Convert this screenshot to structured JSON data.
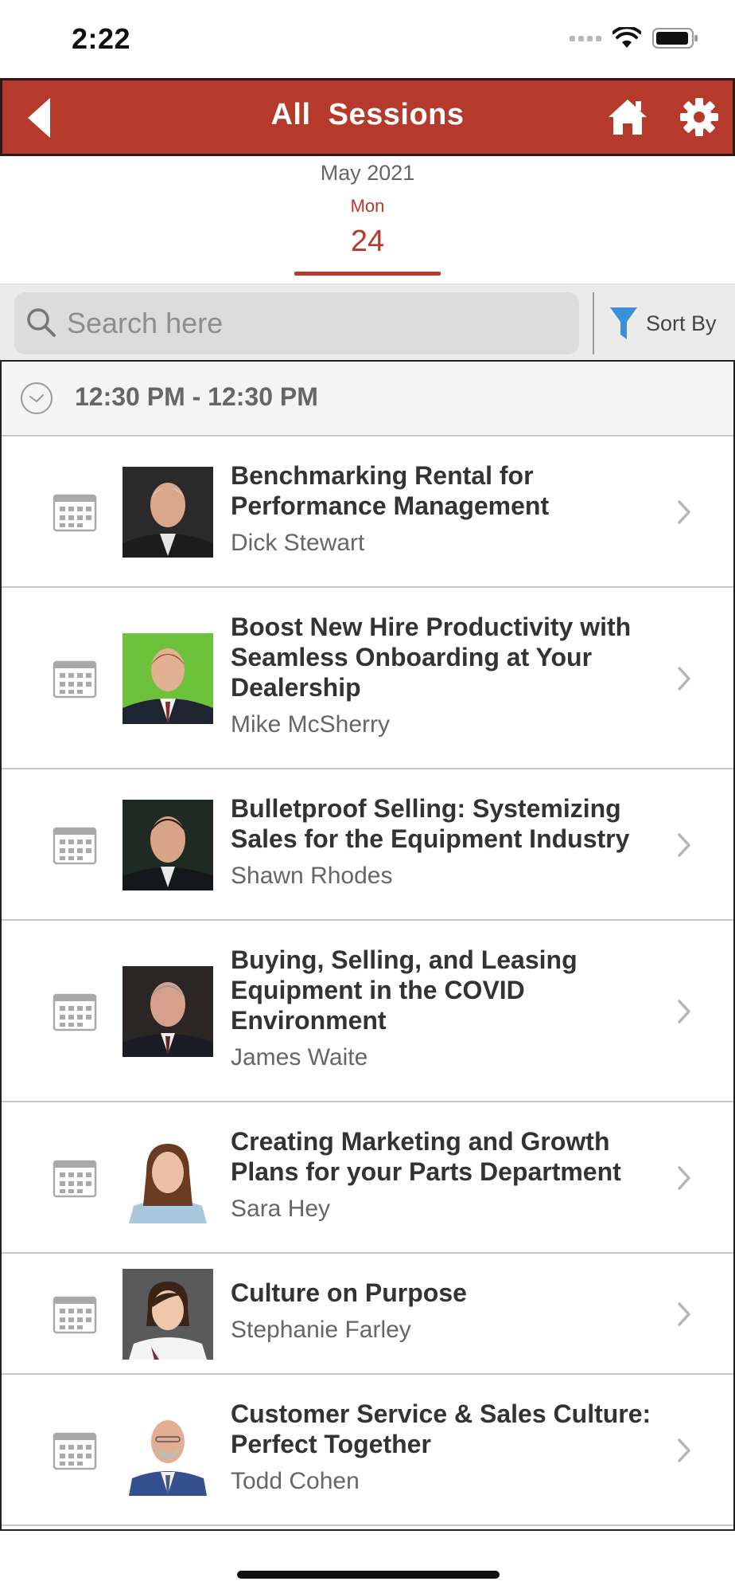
{
  "status_bar": {
    "time": "2:22"
  },
  "header": {
    "title": "All  Sessions"
  },
  "date": {
    "month": "May 2021",
    "weekday": "Mon",
    "day": "24"
  },
  "search": {
    "placeholder": "Search here",
    "value": ""
  },
  "sort": {
    "label": "Sort By"
  },
  "time_slot": "12:30 PM - 12:30 PM",
  "sessions": [
    {
      "title": "Benchmarking Rental for Performance Management",
      "speaker": "Dick Stewart"
    },
    {
      "title": "Boost New Hire Productivity with Seamless Onboarding at Your Dealership",
      "speaker": "Mike McSherry"
    },
    {
      "title": "Bulletproof Selling: Systemizing Sales for the Equipment Industry",
      "speaker": "Shawn Rhodes"
    },
    {
      "title": "Buying, Selling, and Leasing Equipment in the COVID Environment",
      "speaker": "James Waite"
    },
    {
      "title": "Creating Marketing and Growth Plans for your Parts Department",
      "speaker": "Sara Hey"
    },
    {
      "title": "Culture on Purpose",
      "speaker": "Stephanie Farley"
    },
    {
      "title": "Customer Service & Sales Culture: Perfect Together",
      "speaker": "Todd Cohen"
    }
  ],
  "colors": {
    "accent": "#b63a2b",
    "filter_icon": "#3a8fd6"
  }
}
